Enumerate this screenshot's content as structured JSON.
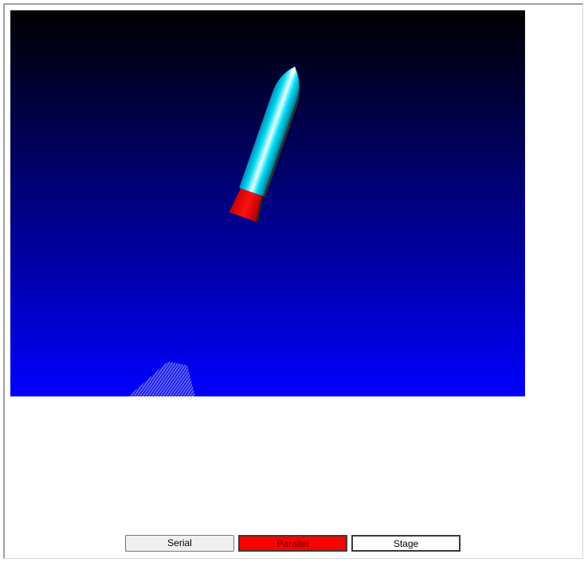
{
  "viewport": {
    "background_top": "#000000",
    "background_bottom": "#0000ff",
    "rocket_body_color": "#00e5ff",
    "nozzle_color": "#ff0000",
    "exhaust_color": "#8fa0ff"
  },
  "controls": {
    "serial_label": "Serial",
    "parallel_label": "Parallel",
    "stage_label": "Stage",
    "serial_color": "#efefef",
    "parallel_color": "#ff0000",
    "stage_color": "#ffffff"
  }
}
